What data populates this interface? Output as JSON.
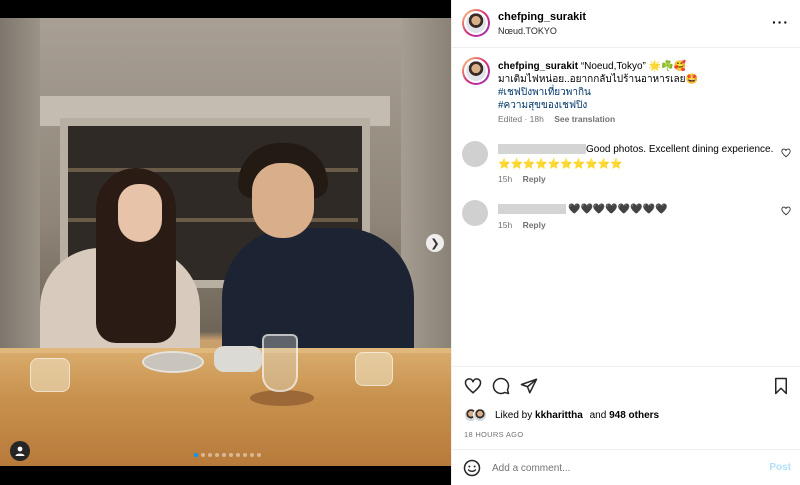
{
  "post": {
    "username": "chefping_surakit",
    "location": "Nœud.TOKYO",
    "more_icon": "more-horizontal-icon"
  },
  "caption": {
    "username": "chefping_surakit",
    "location_quote": "“Noeud,Tokyo”",
    "emojis": "🌟☘️🥰",
    "text": "มาเติมไฟหน่อย..อยากกลับไปร้านอาหารเลย🤩",
    "hashtags": [
      "#เชฟปิงพาเที่ยวพากิน",
      "#ความสุขของเชฟปิง"
    ],
    "edited": "Edited · 18h",
    "see_translation": "See translation"
  },
  "comments": [
    {
      "text": "Good photos. Excellent dining experience.",
      "extra": "⭐⭐⭐⭐⭐⭐⭐⭐⭐⭐",
      "time": "15h",
      "reply": "Reply"
    },
    {
      "text": "🖤🖤🖤🖤🖤🖤🖤🖤",
      "time": "15h",
      "reply": "Reply"
    }
  ],
  "likes": {
    "prefix": "Liked by",
    "user": "kkharittha",
    "and": "and",
    "others": "948 others"
  },
  "timestamp": "18 HOURS AGO",
  "add_comment": {
    "placeholder": "Add a comment...",
    "post_label": "Post"
  },
  "carousel": {
    "count": 10,
    "active_index": 0
  },
  "colors": {
    "accent": "#0095f6",
    "hashtag": "#00376b",
    "muted": "#737373",
    "post_disabled": "#b2dffc"
  }
}
